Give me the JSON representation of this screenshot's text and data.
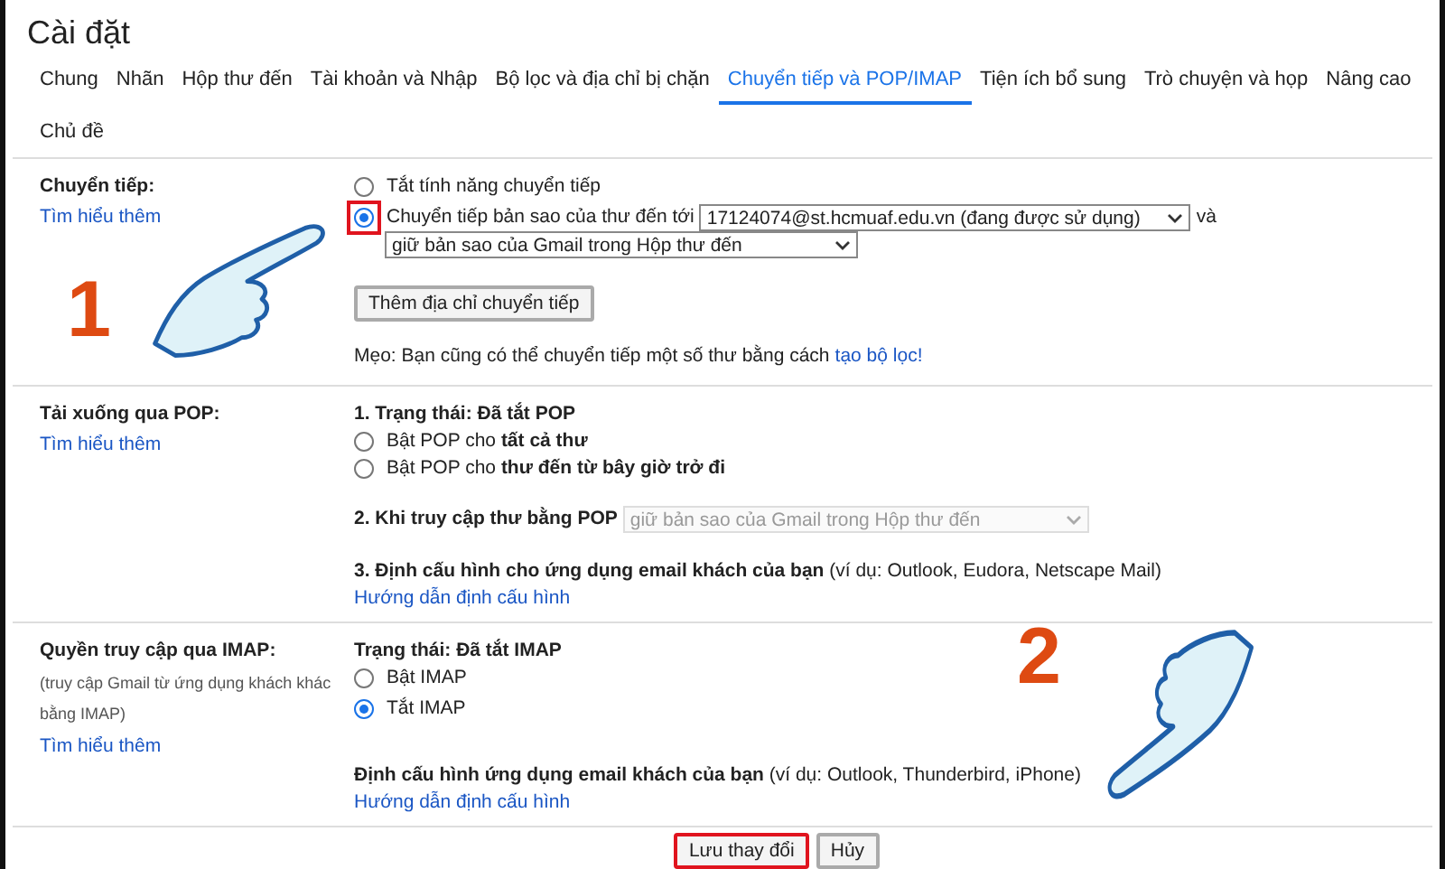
{
  "page_title": "Cài đặt",
  "tabs": [
    {
      "label": "Chung",
      "selected": false
    },
    {
      "label": "Nhãn",
      "selected": false
    },
    {
      "label": "Hộp thư đến",
      "selected": false
    },
    {
      "label": "Tài khoản và Nhập",
      "selected": false
    },
    {
      "label": "Bộ lọc và địa chỉ bị chặn",
      "selected": false
    },
    {
      "label": "Chuyển tiếp và POP/IMAP",
      "selected": true
    },
    {
      "label": "Tiện ích bổ sung",
      "selected": false
    },
    {
      "label": "Trò chuyện và họp",
      "selected": false
    },
    {
      "label": "Nâng cao",
      "selected": false
    },
    {
      "label": "Chủ đề",
      "selected": false
    }
  ],
  "forwarding": {
    "heading": "Chuyển tiếp:",
    "learn_more": "Tìm hiểu thêm",
    "options": [
      {
        "label": "Tắt tính năng chuyển tiếp",
        "selected": false,
        "highlighted": false
      },
      {
        "label": "Chuyển tiếp bản sao của thư đến tới",
        "selected": true,
        "highlighted": true
      }
    ],
    "address_select": {
      "value": "17124074@st.hcmuaf.edu.vn (đang được sử dụng)"
    },
    "conjunction": "và",
    "action_select": {
      "value": "giữ bản sao của Gmail trong Hộp thư đến"
    },
    "add_button": "Thêm địa chỉ chuyển tiếp",
    "tip": "Mẹo: Bạn cũng có thể chuyển tiếp một số thư bằng cách",
    "tip_link": "tạo bộ lọc!"
  },
  "pop": {
    "heading": "Tải xuống qua POP:",
    "learn_more": "Tìm hiểu thêm",
    "status": "1. Trạng thái: Đã tắt POP",
    "options": [
      {
        "label": "Bật POP cho **tất cả thư**",
        "selected": false
      },
      {
        "label": "Bật POP cho **thư đến từ bây giờ trở đi**",
        "selected": false
      }
    ],
    "access_label": "2. Khi truy cập thư bằng POP",
    "access_select": {
      "value": "giữ bản sao của Gmail trong Hộp thư đến",
      "disabled": true
    },
    "configure": "**3. Định cấu hình cho ứng dụng email khách của bạn** (ví dụ: Outlook, Eudora, Netscape Mail)",
    "configure_link": "Hướng dẫn định cấu hình"
  },
  "imap": {
    "heading": "Quyền truy cập qua IMAP:",
    "note": "(truy cập Gmail từ ứng dụng khách khác bằng IMAP)",
    "learn_more": "Tìm hiểu thêm",
    "status": "Trạng thái: Đã tắt IMAP",
    "options": [
      {
        "label": "Bật IMAP",
        "selected": false
      },
      {
        "label": "Tắt IMAP",
        "selected": true
      }
    ],
    "configure": "**Định cấu hình ứng dụng email khách của bạn** (ví dụ: Outlook, Thunderbird, iPhone)",
    "configure_link": "Hướng dẫn định cấu hình"
  },
  "buttons": [
    {
      "label": "Lưu thay đổi",
      "highlighted": true
    },
    {
      "label": "Hủy",
      "highlighted": false
    }
  ],
  "annotations": [
    {
      "label": "1"
    },
    {
      "label": "2"
    }
  ]
}
